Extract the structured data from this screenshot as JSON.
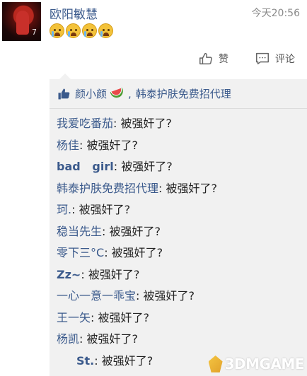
{
  "post": {
    "author": "欧阳敏慧",
    "time": "今天20:56",
    "emojis": [
      "crying-emoji",
      "crying-emoji",
      "crying-emoji",
      "crying-emoji"
    ]
  },
  "actions": {
    "like_label": "赞",
    "comment_label": "评论"
  },
  "likes": {
    "names": [
      "颜小颜",
      "韩泰护肤免费招代理"
    ],
    "separator": ","
  },
  "comments": [
    {
      "name": "我爱吃番茄",
      "sep": ": ",
      "text": "被强奸了?"
    },
    {
      "name": "杨佳",
      "sep": ": ",
      "text": "被强奸了?"
    },
    {
      "name": "bad   girl",
      "sep": ": ",
      "text": "被强奸了?"
    },
    {
      "name": "韩泰护肤免费招代理",
      "sep": ": ",
      "text": "被强奸了?"
    },
    {
      "name": "珂.",
      "sep": ": ",
      "text": "被强奸了?"
    },
    {
      "name": "稳当先生",
      "sep": ": ",
      "text": "被强奸了?"
    },
    {
      "name": "零下三°C",
      "sep": ": ",
      "text": "被强奸了?"
    },
    {
      "name": "Zz~",
      "sep": ": ",
      "text": "被强奸了?"
    },
    {
      "name": "一心一意一乖宝",
      "sep": ": ",
      "text": "被强奸了?"
    },
    {
      "name": "王一矢",
      "sep": ": ",
      "text": "被强奸了?"
    },
    {
      "name": "杨凯",
      "sep": ": ",
      "text": "被强奸了?"
    },
    {
      "name": "St.",
      "sep": ": ",
      "text": "被强奸了?"
    }
  ],
  "watermark": {
    "text": "3DMGAME"
  },
  "colors": {
    "link_blue": "#3b5a8c",
    "panel_bg": "#f1f1f1",
    "time_gray": "#8a8a8a"
  }
}
